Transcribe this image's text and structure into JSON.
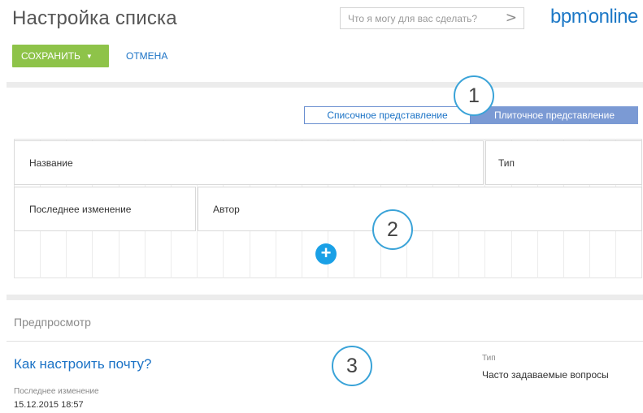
{
  "header": {
    "title": "Настройка списка",
    "search_placeholder": "Что я могу для вас сделать?",
    "search_arrow": ">",
    "logo_main": "bpm",
    "logo_mark": "'",
    "logo_tail": "online"
  },
  "toolbar": {
    "save_label": "СОХРАНИТЬ",
    "save_caret": "▼",
    "cancel_label": "ОТМЕНА"
  },
  "view_switch": {
    "list_label": "Списочное представление",
    "tile_label": "Плиточное представление",
    "selected": "tile"
  },
  "tiles": {
    "name": "Название",
    "type": "Тип",
    "last_modified": "Последнее изменение",
    "author": "Автор",
    "add_symbol": "+"
  },
  "callouts": {
    "one": "1",
    "two": "2",
    "three": "3"
  },
  "preview": {
    "section_title": "Предпросмотр",
    "article_title": "Как настроить почту?",
    "modified_label": "Последнее изменение",
    "modified_value": "15.12.2015 18:57",
    "type_label": "Тип",
    "type_value": "Часто задаваемые вопросы"
  },
  "colors": {
    "accent_blue": "#1c73c6",
    "save_green": "#8ec349",
    "tile_selected": "#7b9ad4",
    "callout_ring": "#3aa3d8",
    "add_button": "#1aa0e6"
  }
}
